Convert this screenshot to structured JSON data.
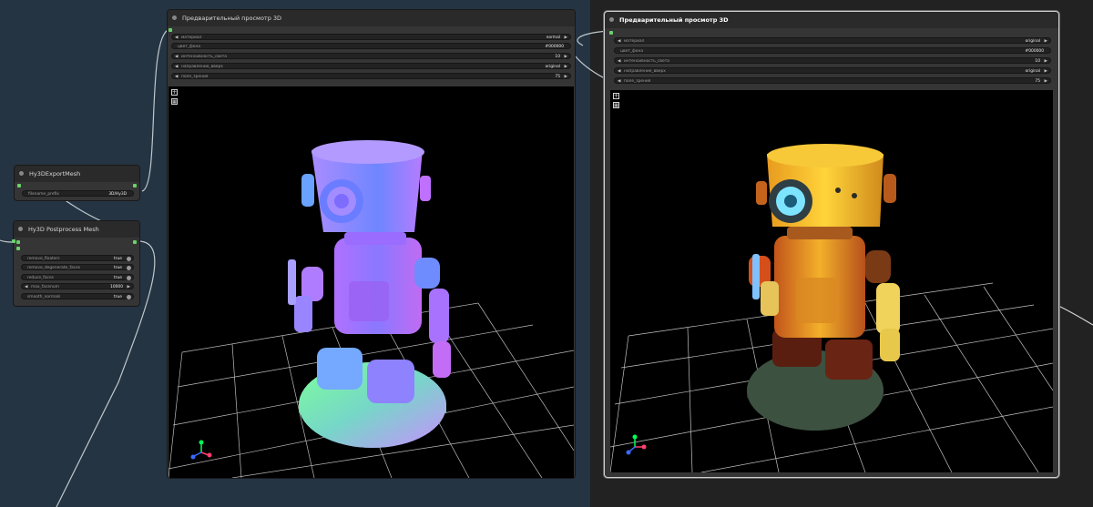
{
  "colors": {
    "canvas_left": "#253443",
    "canvas_right": "#222222",
    "node_body": "#353535",
    "link_green": "#6bd16b",
    "wire": "#bfc8cc"
  },
  "preview_left": {
    "title": "Предварительный просмотр 3D",
    "widgets": [
      {
        "label": "материал",
        "value": "normal"
      },
      {
        "label": "цвет_фона",
        "value": "#000000"
      },
      {
        "label": "интенсивность_света",
        "value": "10"
      },
      {
        "label": "направление_вверх",
        "value": "original"
      },
      {
        "label": "поле_зрения",
        "value": "75"
      }
    ],
    "add_icon": "plus-icon",
    "grid_icon": "grid-icon"
  },
  "preview_right": {
    "title": "Предварительный просмотр 3D",
    "widgets": [
      {
        "label": "материал",
        "value": "original"
      },
      {
        "label": "цвет_фона",
        "value": "#000000"
      },
      {
        "label": "интенсивность_света",
        "value": "10"
      },
      {
        "label": "направление_вверх",
        "value": "original"
      },
      {
        "label": "поле_зрения",
        "value": "75"
      }
    ],
    "add_icon": "plus-icon",
    "grid_icon": "grid-icon"
  },
  "export_node": {
    "title": "Hy3DExportMesh",
    "widgets": [
      {
        "label": "filename_prefix",
        "value": "3D/Hy3D"
      }
    ]
  },
  "postprocess_node": {
    "title": "Hy3D Postprocess Mesh",
    "widgets": [
      {
        "label": "remove_floaters",
        "value": "true"
      },
      {
        "label": "remove_degenerate_faces",
        "value": "true"
      },
      {
        "label": "reduce_faces",
        "value": "true"
      },
      {
        "label": "max_facenum",
        "value": "10000"
      },
      {
        "label": "smooth_normals",
        "value": "true"
      }
    ]
  }
}
